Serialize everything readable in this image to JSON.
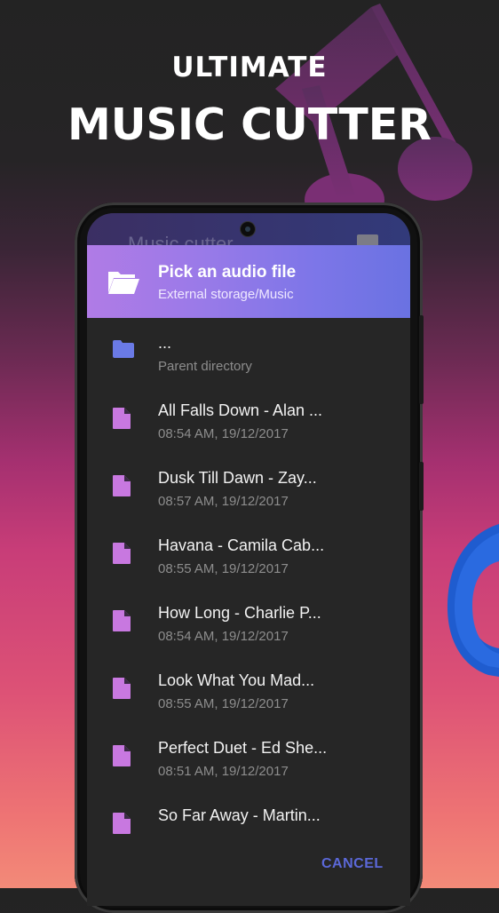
{
  "promo": {
    "headline_line1": "ULTIMATE",
    "headline_line2": "MUSIC CUTTER"
  },
  "app": {
    "title": "Music cutter"
  },
  "dialog": {
    "title": "Pick an audio file",
    "path": "External storage/Music",
    "cancel_label": "CANCEL",
    "items": [
      {
        "type": "folder",
        "name": "...",
        "detail": "Parent directory"
      },
      {
        "type": "file",
        "name": "All Falls Down - Alan ...",
        "detail": "08:54 AM, 19/12/2017"
      },
      {
        "type": "file",
        "name": "Dusk Till Dawn - Zay...",
        "detail": "08:57 AM, 19/12/2017"
      },
      {
        "type": "file",
        "name": "Havana - Camila Cab...",
        "detail": "08:55 AM, 19/12/2017"
      },
      {
        "type": "file",
        "name": "How Long - Charlie P...",
        "detail": "08:54 AM, 19/12/2017"
      },
      {
        "type": "file",
        "name": "Look What You Mad...",
        "detail": "08:55 AM, 19/12/2017"
      },
      {
        "type": "file",
        "name": "Perfect Duet - Ed She...",
        "detail": "08:51 AM, 19/12/2017"
      },
      {
        "type": "file",
        "name": "So Far Away - Martin...",
        "detail": ""
      }
    ]
  },
  "colors": {
    "file_icon": "#c878e0",
    "folder_icon": "#6a7ae6",
    "accent": "#5b68d8"
  }
}
